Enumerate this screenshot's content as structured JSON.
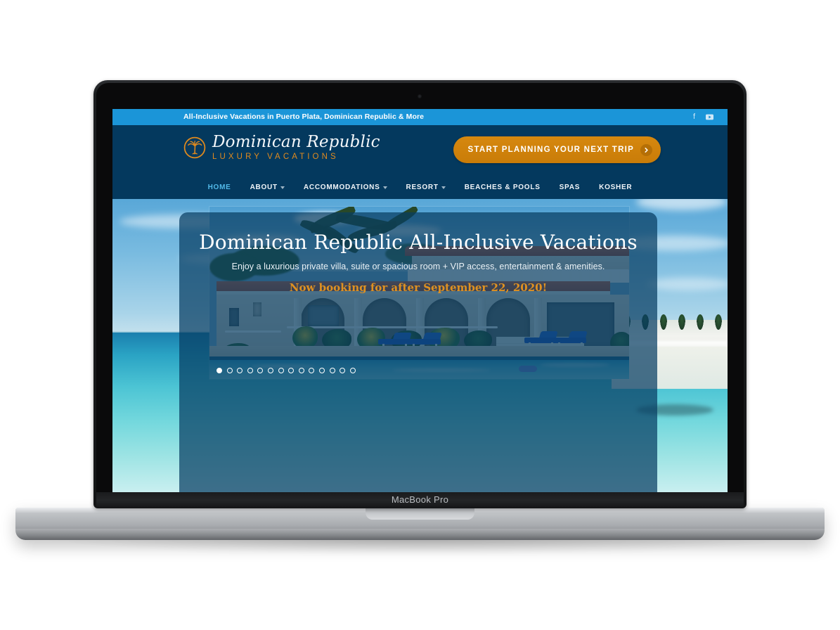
{
  "device": {
    "model_label": "MacBook Pro",
    "webcam": "webcam-dot"
  },
  "site": {
    "topbar": {
      "tagline": "All-Inclusive Vacations in Puerto Plata, Dominican Republic & More",
      "social": [
        {
          "name": "facebook-icon",
          "glyph": "f",
          "label": "Facebook"
        },
        {
          "name": "youtube-icon",
          "glyph": "▶",
          "label": "YouTube"
        }
      ],
      "bg_color": "#1b95d8"
    },
    "header": {
      "logo": {
        "title": "Dominican Republic",
        "subtitle": "LUXURY VACATIONS",
        "icon": "palm-tree-badge-icon",
        "badge_color": "#e08a1e",
        "title_color": "#f4f7fa"
      },
      "cta": {
        "label": "START PLANNING YOUR NEXT TRIP",
        "icon": "chevron-right-circle-icon",
        "bg_color": "#c97c08"
      },
      "bg_color": "#04395e"
    },
    "nav": {
      "items": [
        {
          "label": "HOME",
          "has_caret": false,
          "active": true
        },
        {
          "label": "ABOUT",
          "has_caret": true,
          "active": false
        },
        {
          "label": "ACCOMMODATIONS",
          "has_caret": true,
          "active": false
        },
        {
          "label": "RESORT",
          "has_caret": true,
          "active": false
        },
        {
          "label": "BEACHES & POOLS",
          "has_caret": false,
          "active": false
        },
        {
          "label": "SPAS",
          "has_caret": false,
          "active": false
        },
        {
          "label": "KOSHER",
          "has_caret": false,
          "active": false
        }
      ],
      "active_color": "#52b9e8"
    },
    "hero": {
      "heading": "Dominican Republic All-Inclusive Vacations",
      "subheading": "Enjoy a luxurious private villa, suite or spacious room + VIP access, entertainment & amenities.",
      "notice": "Now booking for after September 22, 2020!",
      "notice_color": "#df9121",
      "slide_alt": "Villa with terracotta roof, arched portico, blue loungers and swimming pool",
      "background_alt": "Turquoise Caribbean sea with white sand beach and palm trees",
      "carousel": {
        "total_dots": 14,
        "active_index": 1
      }
    }
  }
}
